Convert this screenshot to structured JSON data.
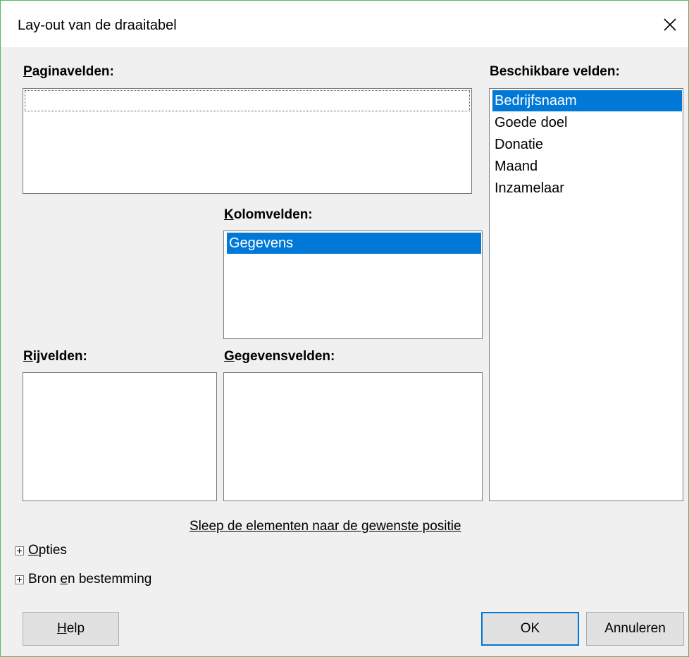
{
  "window": {
    "title": "Lay-out van de draaitabel"
  },
  "labels": {
    "page_fields": {
      "mn": "P",
      "rest": "aginavelden:"
    },
    "column_fields": {
      "mn": "K",
      "rest": "olomvelden:"
    },
    "row_fields": {
      "mn": "R",
      "rest": "ijvelden:"
    },
    "data_fields": {
      "mn": "G",
      "rest": "egevensvelden:"
    },
    "available_fields": "Beschikbare velden:"
  },
  "lists": {
    "available": [
      "Bedrijfsnaam",
      "Goede doel",
      "Donatie",
      "Maand",
      "Inzamelaar"
    ],
    "column": [
      "Gegevens"
    ]
  },
  "hint": "Sleep de elementen naar de gewenste positie",
  "expanders": {
    "options": {
      "mn": "O",
      "rest": "pties"
    },
    "source": {
      "pre": "Bron ",
      "mn": "e",
      "rest": "n bestemming"
    }
  },
  "buttons": {
    "help": {
      "mn": "H",
      "rest": "elp"
    },
    "ok": "OK",
    "cancel": "Annuleren"
  },
  "colors": {
    "selection": "#0078d7",
    "window_border": "#5bb75b"
  }
}
